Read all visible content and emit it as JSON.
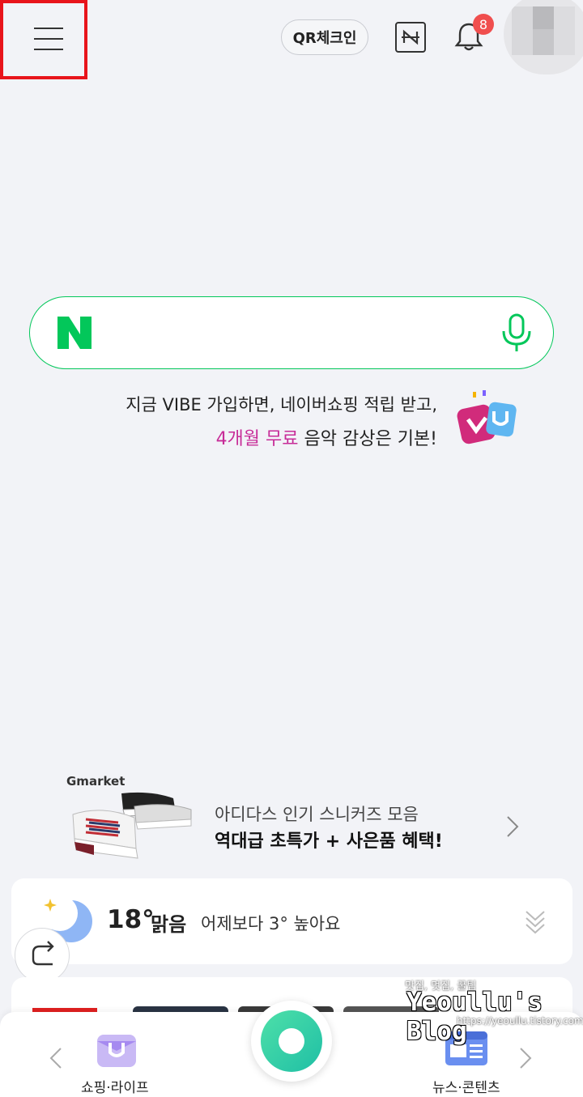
{
  "header": {
    "qr_checkin_label": "QR체크인",
    "notification_count": "8"
  },
  "search": {
    "logo_letter": "N",
    "placeholder": ""
  },
  "promo": {
    "line1": "지금 VIBE 가입하면, 네이버쇼핑 적립 받고,",
    "line2_highlight": "4개월 무료",
    "line2_rest": " 음악 감상은 기본!"
  },
  "ad": {
    "brand": "Gmarket",
    "line1": "아디다스 인기 스니커즈 모음",
    "line2": "역대급 초특가 + 사은품 혜택!"
  },
  "weather": {
    "temperature": "18°",
    "condition": "맑음",
    "comparison": "어제보다 3° 높아요"
  },
  "bottom_nav": {
    "left_label": "쇼핑·라이프",
    "right_label": "뉴스·콘텐츠"
  },
  "watermark": {
    "tagline": "맛집, 멋집, 꿀팁",
    "title": "Yeoullu's Blog",
    "url": "https://yeoullu.tistory.com"
  },
  "colors": {
    "naver_green": "#03c75a",
    "badge_red": "#f04e4e",
    "promo_highlight": "#c72c98",
    "selection_outline": "#e8141b"
  },
  "icons": [
    "menu-icon",
    "naver-n-icon",
    "bell-icon",
    "mic-icon",
    "vibe-icon",
    "moon-icon",
    "share-icon",
    "chevron-right-icon",
    "chevron-left-icon",
    "shopping-bag-icon",
    "news-icon",
    "green-dot-icon",
    "double-chevron-down-icon"
  ]
}
